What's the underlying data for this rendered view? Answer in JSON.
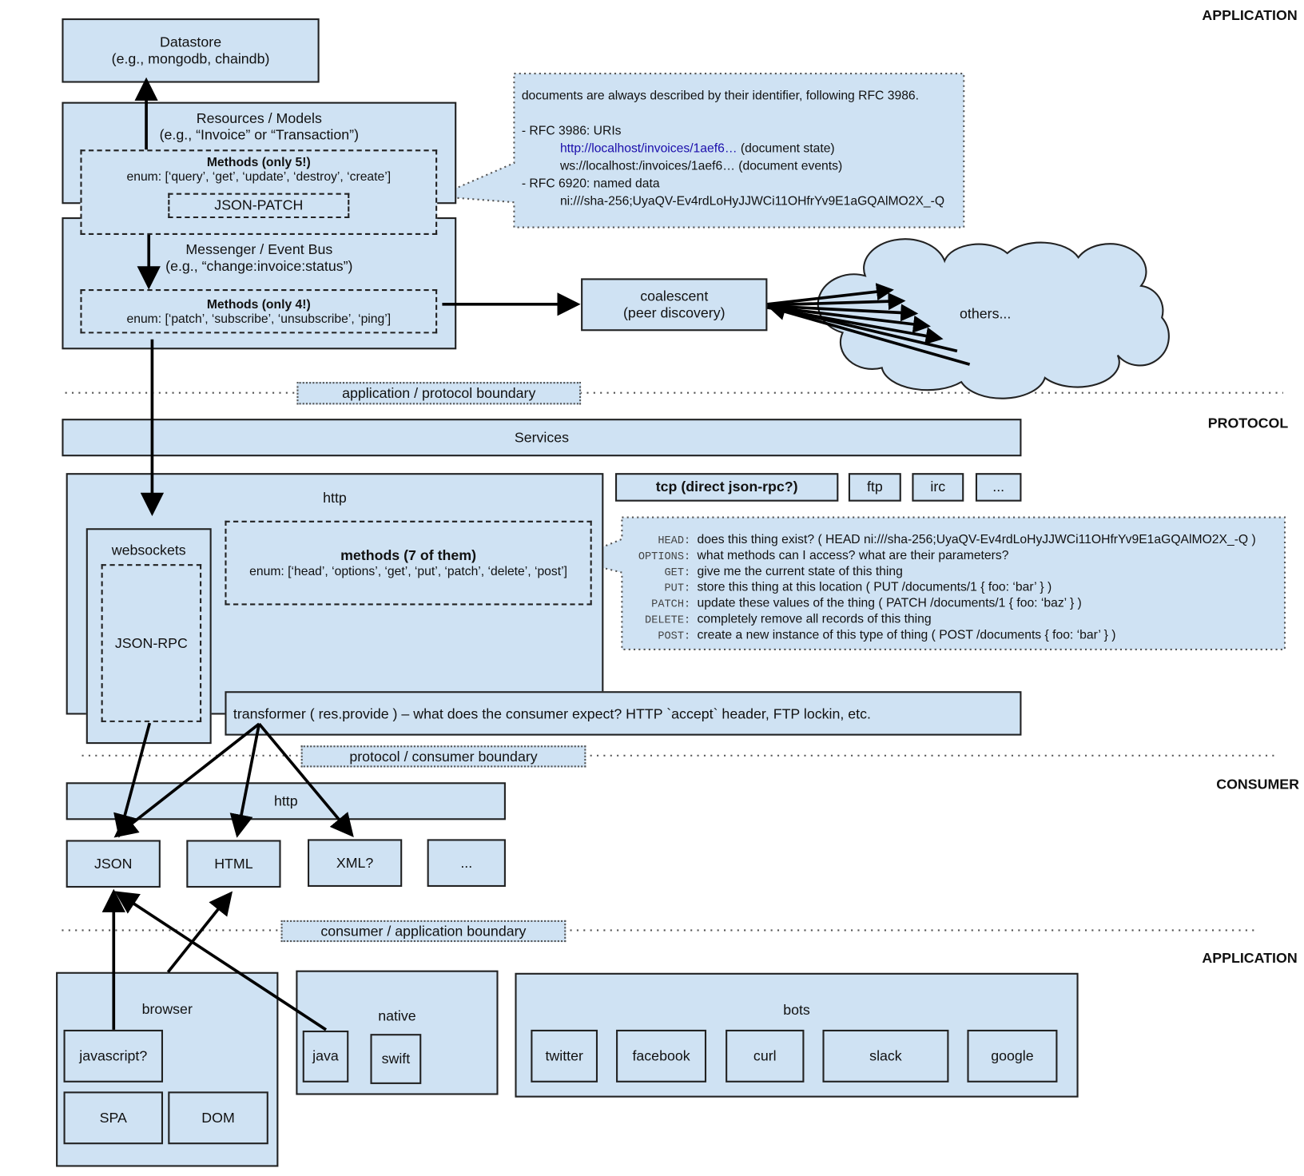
{
  "layers": {
    "application_top": "APPLICATION",
    "protocol": "PROTOCOL",
    "consumer": "CONSUMER",
    "application_bottom": "APPLICATION"
  },
  "boundaries": {
    "app_protocol": "application / protocol boundary",
    "protocol_consumer": "protocol / consumer boundary",
    "consumer_app": "consumer / application boundary"
  },
  "datastore": {
    "title": "Datastore",
    "subtitle": "(e.g., mongodb, chaindb)"
  },
  "resources": {
    "title": "Resources / Models",
    "subtitle": "(e.g., “Invoice” or “Transaction”)",
    "methods_title": "Methods (only 5!)",
    "methods_enum": "enum: [‘query’, ‘get’, ‘update’, ‘destroy’, ‘create’]",
    "json_patch": "JSON-PATCH"
  },
  "messenger": {
    "title": "Messenger / Event Bus",
    "subtitle": "(e.g., “change:invoice:status”)",
    "methods_title": "Methods (only 4!)",
    "methods_enum": "enum: [‘patch’, ‘subscribe’, ‘unsubscribe’, ‘ping’]"
  },
  "coalescent": {
    "title": "coalescent",
    "subtitle": "(peer discovery)"
  },
  "cloud": {
    "label": "others..."
  },
  "rfc_note": {
    "intro": "documents are always described by their identifier, following RFC 3986.",
    "rfc3986": "- RFC 3986: URIs",
    "http_link": "http://localhost/invoices/1aef6…",
    "http_desc": " (document state)",
    "ws": "ws://localhost:/invoices/1aef6… (document events)",
    "rfc6920": "- RFC 6920: named data",
    "ni": "ni:///sha-256;UyaQV-Ev4rdLoHyJJWCi11OHfrYv9E1aGQAlMO2X_-Q"
  },
  "services": "Services",
  "protocol": {
    "http": "http",
    "websockets": "websockets",
    "json_rpc": "JSON-RPC",
    "methods_title": "methods (7 of them)",
    "methods_enum": "enum: [‘head’, ‘options’, ‘get’, ‘put’, ‘patch’, ‘delete’, ‘post’]",
    "tcp": "tcp (direct json-rpc?)",
    "ftp": "ftp",
    "irc": "irc",
    "more": "...",
    "transformer": "transformer ( res.provide ) – what does the consumer expect?  HTTP `accept` header, FTP lockin, etc."
  },
  "http_methods": [
    {
      "method": "HEAD:",
      "desc": "does this thing exist? ( HEAD ni:///sha-256;UyaQV-Ev4rdLoHyJJWCi11OHfrYv9E1aGQAlMO2X_-Q )"
    },
    {
      "method": "OPTIONS:",
      "desc": "what methods can I access?  what are their parameters?"
    },
    {
      "method": "GET:",
      "desc": "give me the current state of this thing"
    },
    {
      "method": "PUT:",
      "desc": "store this thing at this location     (      PUT /documents/1 { foo: ‘bar’ } )"
    },
    {
      "method": "PATCH:",
      "desc": "update these values of the thing ( PATCH /documents/1 { foo: ‘baz’ } )"
    },
    {
      "method": "DELETE:",
      "desc": "completely remove all records of this thing"
    },
    {
      "method": "POST:",
      "desc": "create a new instance of this type of thing ( POST /documents { foo: ‘bar’ } )"
    }
  ],
  "consumer": {
    "http": "http",
    "formats": [
      "JSON",
      "HTML",
      "XML?",
      "..."
    ]
  },
  "apps": {
    "browser": {
      "title": "browser",
      "items": [
        "javascript?",
        "SPA",
        "DOM"
      ]
    },
    "native": {
      "title": "native",
      "items": [
        "java",
        "swift"
      ]
    },
    "bots": {
      "title": "bots",
      "items": [
        "twitter",
        "facebook",
        "curl",
        "slack",
        "google"
      ]
    }
  },
  "colors": {
    "fill": "#cfe2f3",
    "stroke": "#222222",
    "link": "#1a0dab"
  }
}
